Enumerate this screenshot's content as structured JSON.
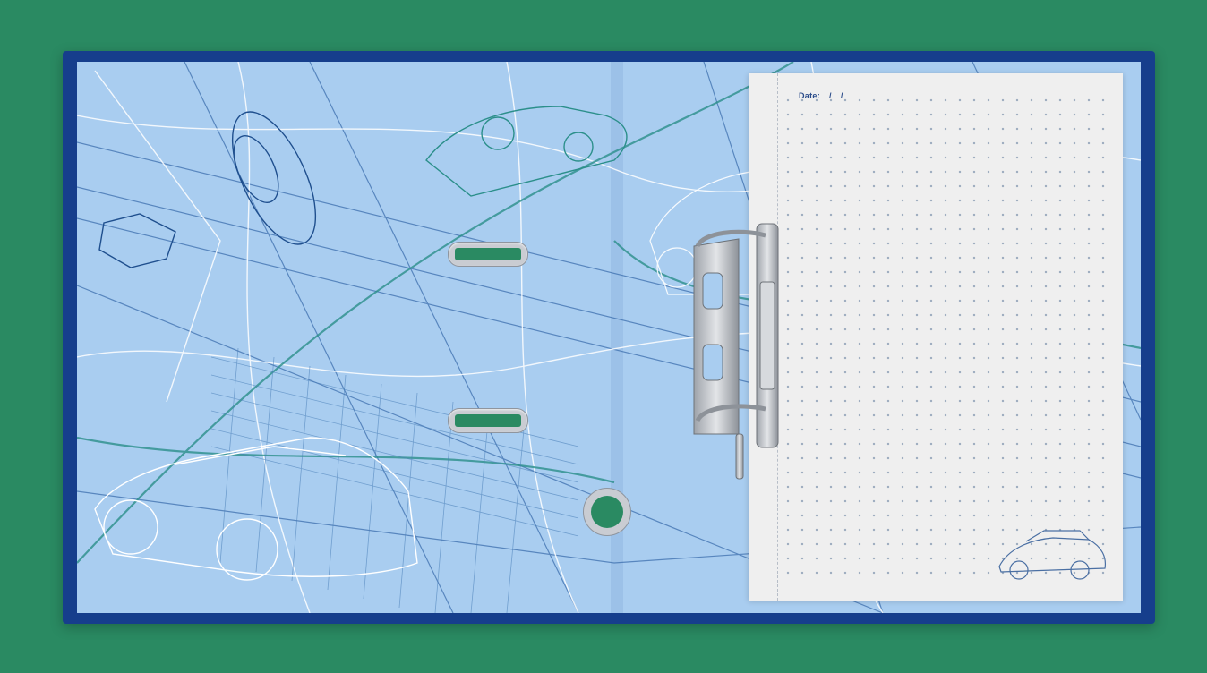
{
  "paper": {
    "date_label": "Date:",
    "date_sep_1": "/",
    "date_sep_2": "/"
  },
  "colors": {
    "background": "#2a8a62",
    "binder_cover": "#163e8c",
    "blueprint": "#a9cdf0",
    "paper": "#efefef",
    "dots": "#8fa0b6"
  },
  "icons": [
    "car-outline-icon",
    "gear-nut-icon",
    "metal-clip-icon"
  ]
}
